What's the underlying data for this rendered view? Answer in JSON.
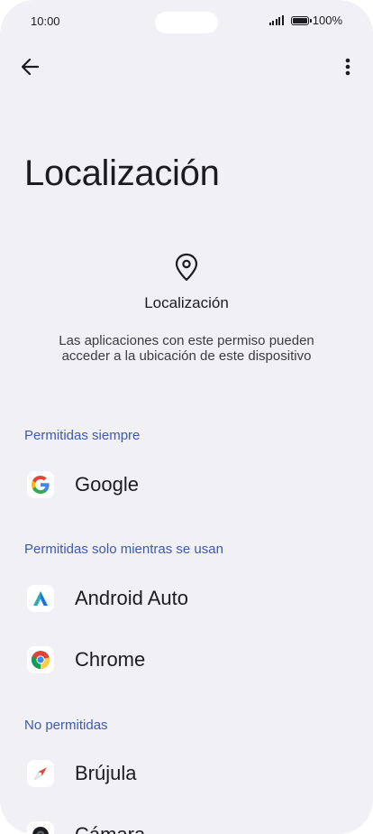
{
  "status_bar": {
    "time": "10:00",
    "battery": "100%"
  },
  "page": {
    "title": "Localización"
  },
  "permission": {
    "name": "Localización",
    "description": "Las aplicaciones con este permiso pueden acceder a la ubicación de este dispositivo"
  },
  "sections": [
    {
      "header": "Permitidas siempre",
      "apps": [
        {
          "label": "Google",
          "icon": "google-icon"
        }
      ]
    },
    {
      "header": "Permitidas solo mientras se usan",
      "apps": [
        {
          "label": "Android Auto",
          "icon": "android-auto-icon"
        },
        {
          "label": "Chrome",
          "icon": "chrome-icon"
        }
      ]
    },
    {
      "header": "No permitidas",
      "apps": [
        {
          "label": "Brújula",
          "icon": "compass-icon"
        },
        {
          "label": "Cámara",
          "icon": "camera-icon"
        }
      ]
    }
  ],
  "colors": {
    "background": "#f1f0f5",
    "section_header": "#3f5aa8",
    "text": "#1c1b1f"
  }
}
